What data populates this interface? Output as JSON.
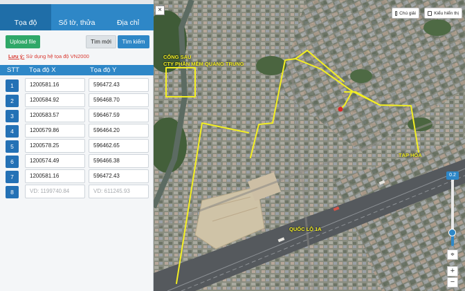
{
  "tabs": [
    {
      "label": "Tọa độ",
      "active": true
    },
    {
      "label": "Số tờ, thửa",
      "active": false
    },
    {
      "label": "Địa chỉ",
      "active": false
    }
  ],
  "buttons": {
    "upload": "Upload file",
    "new": "Tìm mới",
    "search": "Tìm kiếm"
  },
  "note": {
    "label": "Lưu ý:",
    "text": " Sử dụng hệ tọa độ VN2000"
  },
  "table": {
    "headers": {
      "stt": "STT",
      "x": "Tọa độ X",
      "y": "Tọa độ Y"
    },
    "rows": [
      {
        "stt": "1",
        "x": "1200581.16",
        "y": "596472.43"
      },
      {
        "stt": "2",
        "x": "1200584.92",
        "y": "596468.70"
      },
      {
        "stt": "3",
        "x": "1200583.57",
        "y": "596467.59"
      },
      {
        "stt": "4",
        "x": "1200579.86",
        "y": "596464.20"
      },
      {
        "stt": "5",
        "x": "1200578.25",
        "y": "596462.65"
      },
      {
        "stt": "6",
        "x": "1200574.49",
        "y": "596466.38"
      },
      {
        "stt": "7",
        "x": "1200581.16",
        "y": "596472.43"
      },
      {
        "stt": "8",
        "x_placeholder": "VD: 1199740.84",
        "y_placeholder": "VD: 611245.93"
      }
    ]
  },
  "map": {
    "close": "×",
    "legend_button": "Chú giải",
    "layer_button": "Kiểu hiển thị",
    "labels": {
      "gate_line1": "CỔNG SAU",
      "gate_line2": "CTY PHẦN MỀM QUANG TRUNG",
      "shop": "TẠP HÓA",
      "highway": "QUỐC LỘ 1A"
    },
    "opacity_value": "0.2",
    "opacity_fraction": 0.2,
    "zoom_in": "+",
    "zoom_out": "−",
    "locate_icon": "crosshair-icon",
    "colors": {
      "route": "#f3ef22",
      "accent": "#2e87c7",
      "pin": "#d62828"
    }
  }
}
